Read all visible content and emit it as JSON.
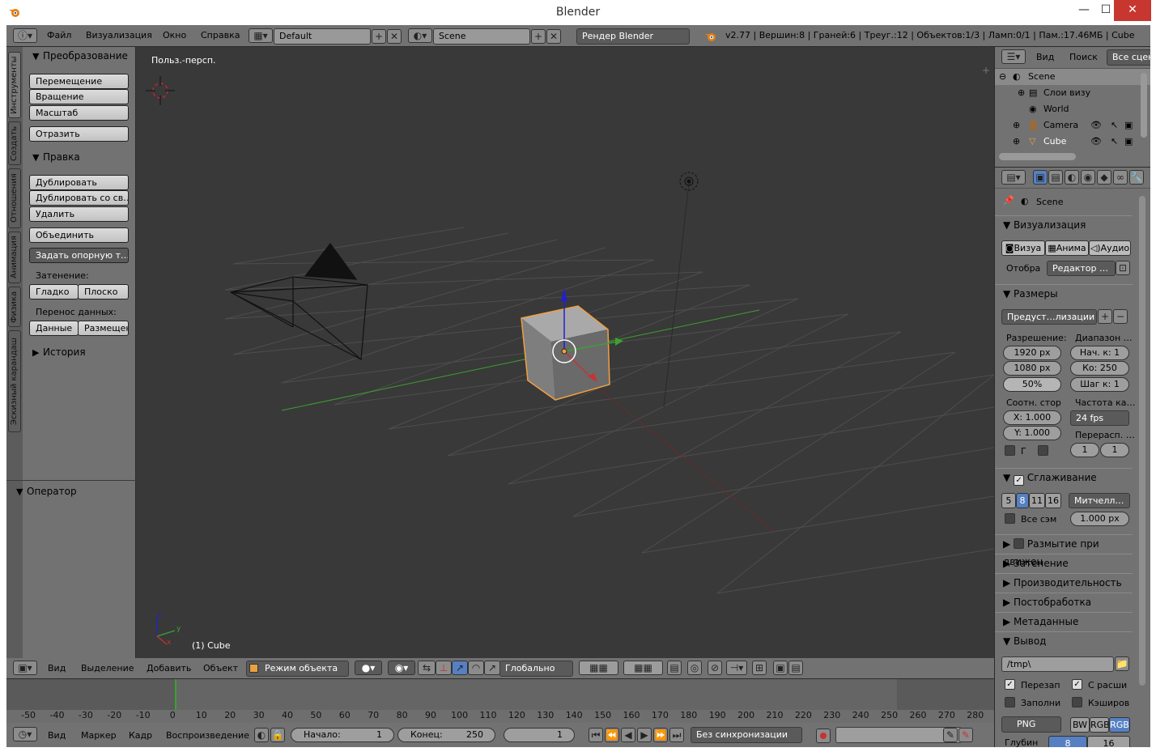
{
  "window": {
    "title": "Blender",
    "minimize": "—",
    "maximize": "☐",
    "close": "✕"
  },
  "info_header": {
    "menus": [
      "Файл",
      "Визуализация",
      "Окно",
      "Справка"
    ],
    "layout": "Default",
    "scene": "Scene",
    "render_engine": "Рендер Blender",
    "stats": "v2.77 | Вершин:8 | Граней:6 | Треуг.:12 | Объектов:1/3 | Ламп:0/1 | Пам.:17.46МБ | Cube"
  },
  "toolshelf": {
    "tabs": [
      "Инструменты",
      "Создать",
      "Отношения",
      "Анимация",
      "Физика",
      "Эскизный карандаш"
    ],
    "transform_title": "Преобразование",
    "translate": "Перемещение",
    "rotate": "Вращение",
    "scale": "Масштаб",
    "mirror": "Отразить",
    "edit_title": "Правка",
    "duplicate": "Дублировать",
    "duplicate_linked": "Дублировать со св…",
    "delete": "Удалить",
    "join": "Объединить",
    "set_origin": "Задать опорную т…",
    "shading_label": "Затенение:",
    "smooth": "Гладко",
    "flat": "Плоско",
    "data_transfer_label": "Перенос данных:",
    "data": "Данные",
    "layouts": "Размещен",
    "history_title": "История",
    "operator_title": "Оператор"
  },
  "viewport": {
    "view_name": "Польз.-персп.",
    "object_label": "(1) Cube",
    "axes": [
      "z",
      "y",
      "x"
    ]
  },
  "view3d_header": {
    "menus": [
      "Вид",
      "Выделение",
      "Добавить",
      "Объект"
    ],
    "mode": "Режим объекта",
    "orientation": "Глобально"
  },
  "timeline": {
    "ticks": [
      "-50",
      "-40",
      "-30",
      "-20",
      "-10",
      "0",
      "10",
      "20",
      "30",
      "40",
      "50",
      "60",
      "70",
      "80",
      "90",
      "100",
      "110",
      "120",
      "130",
      "140",
      "150",
      "160",
      "170",
      "180",
      "190",
      "200",
      "210",
      "220",
      "230",
      "240",
      "250",
      "260",
      "270",
      "280"
    ],
    "menus": [
      "Вид",
      "Маркер",
      "Кадр",
      "Воспроизведение"
    ],
    "start_label": "Начало:",
    "start_value": "1",
    "end_label": "Конец:",
    "end_value": "250",
    "current": "1",
    "sync": "Без синхронизации"
  },
  "outliner": {
    "menus": [
      "Вид",
      "Поиск",
      "Все сцен"
    ],
    "items": [
      "Scene",
      "Слои визу",
      "World",
      "Camera",
      "Cube"
    ]
  },
  "properties": {
    "context": "Scene",
    "render_title": "Визуализация",
    "render_btn": "Визуа",
    "anim_btn": "Анима",
    "audio_btn": "Аудио",
    "display_label": "Отобра",
    "display_value": "Редактор …",
    "dimensions_title": "Размеры",
    "preset": "Предуст…лизации",
    "resolution_label": "Разрешение:",
    "range_label": "Диапазон …",
    "res_x": "1920 px",
    "res_y": "1080 px",
    "res_pct": "50%",
    "frame_start": "Нач. к: 1",
    "frame_end": "Ко:  250",
    "frame_step": "Шаг к: 1",
    "aspect_label": "Соотн. стор",
    "fps_label": "Частота ка…",
    "aspect_x": "X: 1.000",
    "aspect_y": "Y: 1.000",
    "fps": "24 fps",
    "remap_label": "Перерасп. …",
    "remap_old": "1",
    "remap_new": "1",
    "border_label": "Г",
    "aa_title": "Сглаживание",
    "aa_samples": [
      "5",
      "8",
      "11",
      "16"
    ],
    "aa_filter": "Митчелл…",
    "full_sample": "Все сэм",
    "filter_size": "1.000 px",
    "motion_blur": "Размытие при движен",
    "shading": "Затенение",
    "performance": "Производительность",
    "post_processing": "Постобработка",
    "metadata": "Метаданные",
    "output_title": "Вывод",
    "output_path": "/tmp\\",
    "overwrite": "Перезап",
    "file_ext": "С расши",
    "placeholders": "Заполни",
    "cache_result": "Кэширов",
    "format": "PNG",
    "bw": "BW",
    "rgb": "RGB",
    "rgba": "RGB",
    "depth_label": "Глубин",
    "depth_8": "8",
    "depth_16": "16"
  },
  "colors": {
    "viewport_bg": "#393939",
    "header": "#727272",
    "panel": "#727272",
    "selected_outline": "#f0a040",
    "x_axis": "#c83232",
    "y_axis": "#3ca032",
    "z_axis": "#2020d0",
    "active_blue": "#5680c2"
  }
}
